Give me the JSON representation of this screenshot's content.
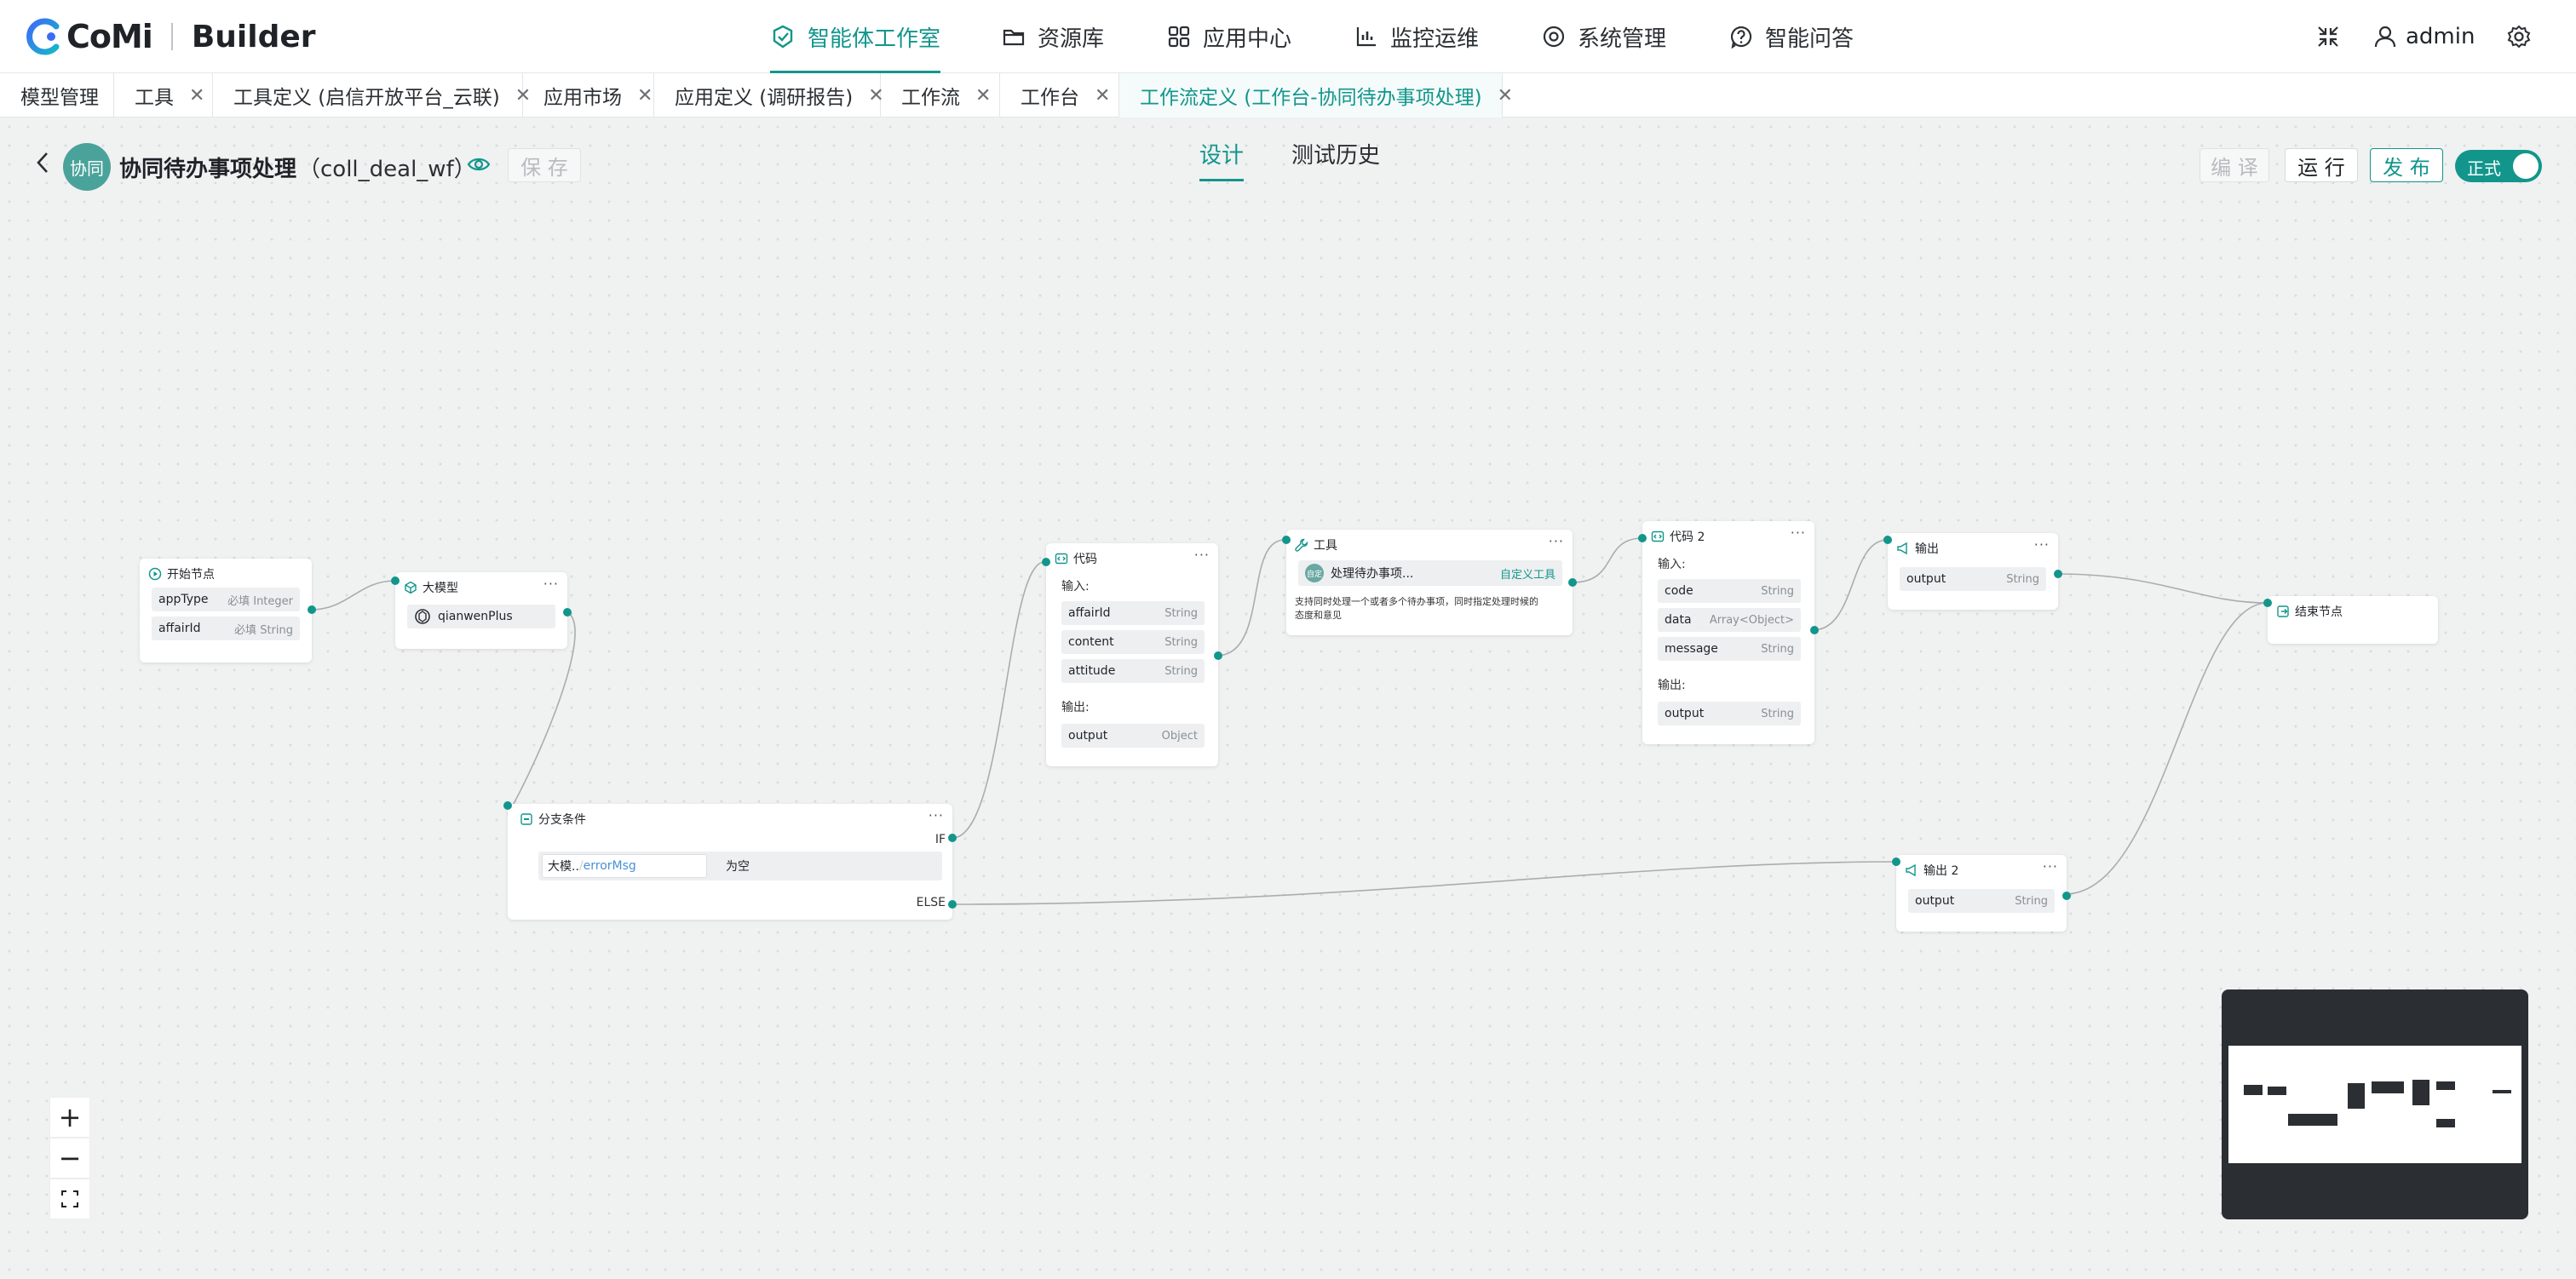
{
  "brand": {
    "logo_text": "CoMi",
    "product": "Builder"
  },
  "nav": [
    {
      "label": "智能体工作室",
      "icon": "agent-studio-icon",
      "active": true
    },
    {
      "label": "资源库",
      "icon": "folder-icon"
    },
    {
      "label": "应用中心",
      "icon": "apps-grid-icon"
    },
    {
      "label": "监控运维",
      "icon": "monitor-chart-icon"
    },
    {
      "label": "系统管理",
      "icon": "settings-circle-icon"
    },
    {
      "label": "智能问答",
      "icon": "help-question-icon"
    }
  ],
  "user": {
    "name": "admin"
  },
  "tabs": [
    {
      "label": "模型管理",
      "closable": false
    },
    {
      "label": "工具",
      "closable": true
    },
    {
      "label": "工具定义 (启信开放平台_云联)",
      "closable": true
    },
    {
      "label": "应用市场",
      "closable": false
    },
    {
      "label": "应用定义 (调研报告)",
      "closable": true
    },
    {
      "label": "工作流",
      "closable": true
    },
    {
      "label": "工作台",
      "closable": true
    },
    {
      "label": "工作流定义 (工作台-协同待办事项处理)",
      "closable": true,
      "active": true
    }
  ],
  "workflow": {
    "avatar": "协同",
    "name": "协同待办事项处理",
    "code": "（coll_deal_wf）",
    "save": "保 存",
    "view_tabs": [
      "设计",
      "测试历史"
    ],
    "compile": "编 译",
    "run": "运 行",
    "publish": "发 布",
    "mode_toggle": "正式"
  },
  "nodes": {
    "start": {
      "title": "开始节点",
      "params": [
        {
          "name": "appType",
          "req": "必填",
          "type": "Integer"
        },
        {
          "name": "affairId",
          "req": "必填",
          "type": "String"
        }
      ]
    },
    "llm": {
      "title": "大模型",
      "model": "qianwenPlus"
    },
    "branch": {
      "title": "分支条件",
      "cond_var": "大模..",
      "cond_var2": "errorMsg",
      "cond_op": "为空",
      "if_label": "IF",
      "else_label": "ELSE"
    },
    "code1": {
      "title": "代码",
      "in_label": "输入:",
      "inputs": [
        {
          "name": "affairId",
          "type": "String"
        },
        {
          "name": "content",
          "type": "String"
        },
        {
          "name": "attitude",
          "type": "String"
        }
      ],
      "out_label": "输出:",
      "outputs": [
        {
          "name": "output",
          "type": "Object"
        }
      ]
    },
    "tool": {
      "title": "工具",
      "badge": "自定",
      "tool_name": "处理待办事项...",
      "tool_tag": "自定义工具",
      "desc_line1": "支持同时处理一个或者多个待办事项，同时指定处理时候的",
      "desc_line2": "态度和意见"
    },
    "code2": {
      "title": "代码 2",
      "in_label": "输入:",
      "inputs": [
        {
          "name": "code",
          "type": "String"
        },
        {
          "name": "data",
          "type": "Array<Object>"
        },
        {
          "name": "message",
          "type": "String"
        }
      ],
      "out_label": "输出:",
      "outputs": [
        {
          "name": "output",
          "type": "String"
        }
      ]
    },
    "out1": {
      "title": "输出",
      "outputs": [
        {
          "name": "output",
          "type": "String"
        }
      ]
    },
    "end": {
      "title": "结束节点"
    },
    "out2": {
      "title": "输出 2",
      "outputs": [
        {
          "name": "output",
          "type": "String"
        }
      ]
    }
  },
  "zoom": {
    "in": "+",
    "out": "−"
  },
  "colors": {
    "accent": "#12968c",
    "minimap_bg": "#2b2f33"
  }
}
